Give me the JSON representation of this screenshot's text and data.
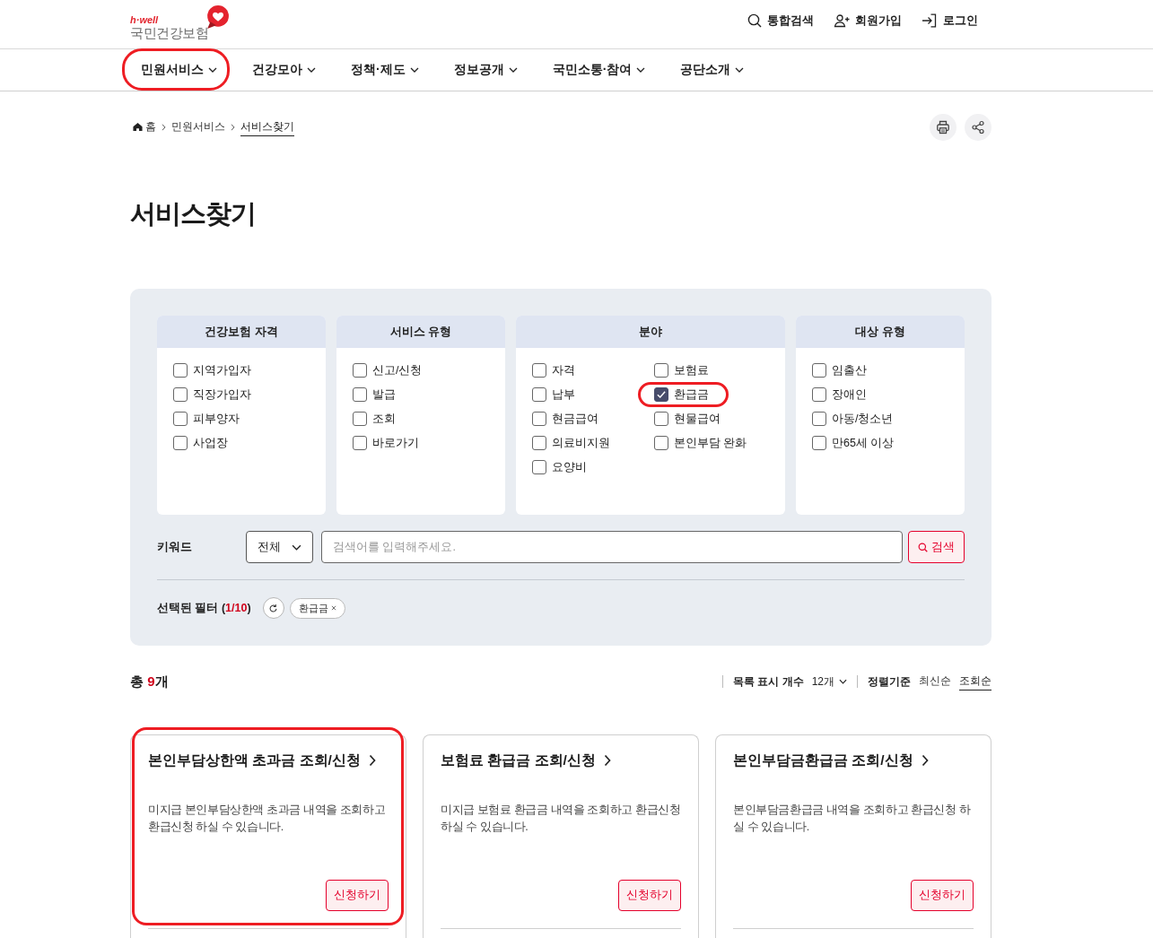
{
  "logo": {
    "tagline": "h·well",
    "name": "국민건강보험"
  },
  "utility_links": [
    {
      "kind": "search",
      "label": "통합검색"
    },
    {
      "kind": "signup",
      "label": "회원가입"
    },
    {
      "kind": "login",
      "label": "로그인"
    }
  ],
  "nav": [
    {
      "label": "민원서비스",
      "highlighted": true
    },
    {
      "label": "건강모아",
      "highlighted": false
    },
    {
      "label": "정책·제도",
      "highlighted": false
    },
    {
      "label": "정보공개",
      "highlighted": false
    },
    {
      "label": "국민소통·참여",
      "highlighted": false
    },
    {
      "label": "공단소개",
      "highlighted": false
    }
  ],
  "breadcrumb": [
    {
      "kind": "home",
      "label": "홈",
      "current": false
    },
    {
      "kind": "page",
      "label": "민원서비스",
      "current": false
    },
    {
      "kind": "page",
      "label": "서비스찾기",
      "current": true
    }
  ],
  "title": "서비스찾기",
  "filters": [
    {
      "heading": "건강보험 자격",
      "kind": "list",
      "options": [
        {
          "label": "지역가입자",
          "checked": false,
          "highlighted": false
        },
        {
          "label": "직장가입자",
          "checked": false,
          "highlighted": false
        },
        {
          "label": "피부양자",
          "checked": false,
          "highlighted": false
        },
        {
          "label": "사업장",
          "checked": false,
          "highlighted": false
        }
      ]
    },
    {
      "heading": "서비스 유형",
      "kind": "list",
      "options": [
        {
          "label": "신고/신청",
          "checked": false,
          "highlighted": false
        },
        {
          "label": "발급",
          "checked": false,
          "highlighted": false
        },
        {
          "label": "조회",
          "checked": false,
          "highlighted": false
        },
        {
          "label": "바로가기",
          "checked": false,
          "highlighted": false
        }
      ]
    },
    {
      "heading": "분야",
      "kind": "grid",
      "options": [
        {
          "label": "자격",
          "checked": false,
          "highlighted": false
        },
        {
          "label": "보험료",
          "checked": false,
          "highlighted": false
        },
        {
          "label": "납부",
          "checked": false,
          "highlighted": false
        },
        {
          "label": "환급금",
          "checked": true,
          "highlighted": true
        },
        {
          "label": "현금급여",
          "checked": false,
          "highlighted": false
        },
        {
          "label": "현물급여",
          "checked": false,
          "highlighted": false
        },
        {
          "label": "의료비지원",
          "checked": false,
          "highlighted": false
        },
        {
          "label": "본인부담 완화",
          "checked": false,
          "highlighted": false
        },
        {
          "label": "요양비",
          "checked": false,
          "highlighted": false
        }
      ]
    },
    {
      "heading": "대상 유형",
      "kind": "list",
      "options": [
        {
          "label": "임출산",
          "checked": false,
          "highlighted": false
        },
        {
          "label": "장애인",
          "checked": false,
          "highlighted": false
        },
        {
          "label": "아동/청소년",
          "checked": false,
          "highlighted": false
        },
        {
          "label": "만65세 이상",
          "checked": false,
          "highlighted": false
        }
      ]
    }
  ],
  "keyword": {
    "label": "키워드",
    "scope": "전체",
    "placeholder": "검색어를 입력해주세요.",
    "button": "검색"
  },
  "selected_filters": {
    "label": "선택된 필터 (",
    "count": "1/10",
    "label_end": ")",
    "chips": [
      {
        "label": "환급금"
      }
    ]
  },
  "results": {
    "total_prefix": "총 ",
    "total_count": "9",
    "total_suffix": "개",
    "page_size_label": "목록 표시 개수",
    "page_size": "12개",
    "sort_label": "정렬기준",
    "sort_options": [
      {
        "label": "최신순",
        "selected": false
      },
      {
        "label": "조회순",
        "selected": true
      }
    ]
  },
  "cards": [
    {
      "title": "본인부담상한액 초과금 조회/신청",
      "description": "미지급 본인부담상한액 초과금 내역을 조회하고 환급신청 하실 수 있습니다.",
      "button": "신청하기",
      "highlighted": true
    },
    {
      "title": "보험료 환급금 조회/신청",
      "description": "미지급 보험료 환급금 내역을 조회하고 환급신청 하실 수 있습니다.",
      "button": "신청하기",
      "highlighted": false
    },
    {
      "title": "본인부담금환급금 조회/신청",
      "description": "본인부담금환급금 내역을 조회하고 환급신청 하실 수 있습니다.",
      "button": "신청하기",
      "highlighted": false
    }
  ]
}
